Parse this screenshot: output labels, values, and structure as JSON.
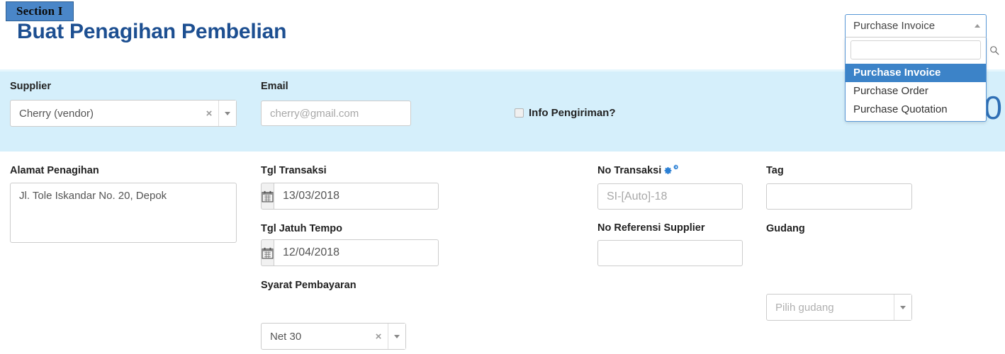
{
  "header": {
    "section_tab": "Section I",
    "title": "Buat Penagihan Pembelian"
  },
  "doc_type_dropdown": {
    "selected": "Purchase Invoice",
    "search_value": "",
    "search_placeholder": "",
    "options": [
      "Purchase Invoice",
      "Purchase Order",
      "Purchase Quotation"
    ],
    "selected_index": 0
  },
  "totals": {
    "amount": "0"
  },
  "form": {
    "supplier": {
      "label": "Supplier",
      "value": "Cherry (vendor)",
      "clear_glyph": "×"
    },
    "email": {
      "label": "Email",
      "value": "",
      "placeholder": "cherry@gmail.com"
    },
    "info_pengiriman": {
      "label": "Info Pengiriman?",
      "checked": false
    },
    "alamat_penagihan": {
      "label": "Alamat Penagihan",
      "value": "Jl. Tole Iskandar No. 20, Depok"
    },
    "tgl_transaksi": {
      "label": "Tgl Transaksi",
      "value": "13/03/2018"
    },
    "tgl_jatuh_tempo": {
      "label": "Tgl Jatuh Tempo",
      "value": "12/04/2018"
    },
    "syarat_pembayaran": {
      "label": "Syarat Pembayaran",
      "value": "Net 30",
      "clear_glyph": "×"
    },
    "no_transaksi": {
      "label": "No Transaksi",
      "value": "",
      "placeholder": "SI-[Auto]-18"
    },
    "no_referensi_supplier": {
      "label": "No Referensi Supplier",
      "value": "",
      "placeholder": ""
    },
    "tag": {
      "label": "Tag",
      "value": "",
      "placeholder": ""
    },
    "gudang": {
      "label": "Gudang",
      "value": "",
      "placeholder": "Pilih gudang"
    }
  },
  "colors": {
    "band": "#d5effb",
    "title": "#1d4f91",
    "tab": "#4a86c8",
    "highlight": "#3c83c8",
    "gear": "#2a7fd4"
  }
}
